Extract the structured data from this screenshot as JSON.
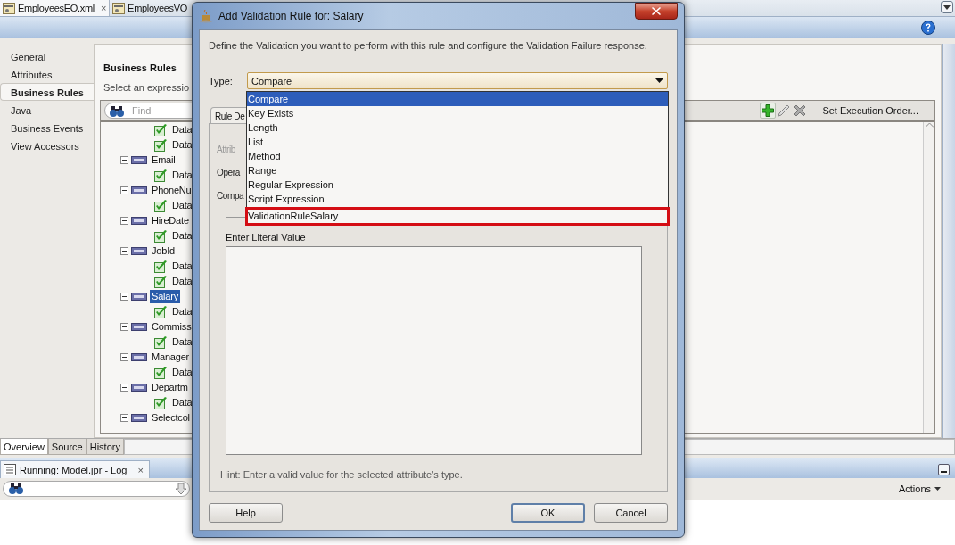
{
  "doc_tabs": [
    {
      "label": "EmployeesEO.xml",
      "close": "×",
      "selected": true
    },
    {
      "label": "EmployeesVO",
      "selected": false
    }
  ],
  "nav": [
    {
      "label": "General",
      "selected": false
    },
    {
      "label": "Attributes",
      "selected": false
    },
    {
      "label": "Business Rules",
      "selected": true
    },
    {
      "label": "Java",
      "selected": false
    },
    {
      "label": "Business Events",
      "selected": false
    },
    {
      "label": "View Accessors",
      "selected": false
    }
  ],
  "panel": {
    "title": "Business Rules",
    "subtitle": "Select an expressio",
    "find_placeholder": "Find",
    "toolbar_action": "Set Execution Order..."
  },
  "tree": [
    {
      "kind": "rule",
      "label": "Data",
      "selected": false
    },
    {
      "kind": "rule",
      "label": "Data",
      "selected": false
    },
    {
      "kind": "attribute",
      "label": "Email",
      "selected": false,
      "children": [
        {
          "kind": "rule",
          "label": "Data",
          "selected": false
        }
      ]
    },
    {
      "kind": "attribute",
      "label": "PhoneNu",
      "selected": false,
      "children": [
        {
          "kind": "rule",
          "label": "Data",
          "selected": false
        }
      ]
    },
    {
      "kind": "attribute",
      "label": "HireDate",
      "selected": false,
      "children": [
        {
          "kind": "rule",
          "label": "Data",
          "selected": false
        }
      ]
    },
    {
      "kind": "attribute",
      "label": "JobId",
      "selected": false,
      "children": [
        {
          "kind": "rule",
          "label": "Data",
          "selected": false
        },
        {
          "kind": "rule",
          "label": "Data",
          "selected": false
        }
      ]
    },
    {
      "kind": "attribute",
      "label": "Salary",
      "selected": true,
      "children": [
        {
          "kind": "rule",
          "label": "Data",
          "selected": false
        }
      ]
    },
    {
      "kind": "attribute",
      "label": "Commiss",
      "selected": false,
      "children": [
        {
          "kind": "rule",
          "label": "Data",
          "selected": false
        }
      ]
    },
    {
      "kind": "attribute",
      "label": "Manager",
      "selected": false,
      "children": [
        {
          "kind": "rule",
          "label": "Data",
          "selected": false
        }
      ]
    },
    {
      "kind": "attribute",
      "label": "Departm",
      "selected": false,
      "children": [
        {
          "kind": "rule",
          "label": "Data",
          "selected": false
        }
      ]
    },
    {
      "kind": "attribute",
      "label": "Selectcol",
      "selected": false
    }
  ],
  "bottom_tabs": [
    {
      "label": "Overview",
      "selected": true
    },
    {
      "label": "Source",
      "selected": false
    },
    {
      "label": "History",
      "selected": false
    }
  ],
  "log": {
    "title": "Running: Model.jpr - Log",
    "close": "×",
    "actions": "Actions"
  },
  "dialog": {
    "title": "Add Validation Rule for: Salary",
    "description": "Define the Validation you want to perform with this rule and configure the Validation Failure response.",
    "type_label": "Type:",
    "type_value": "Compare",
    "options": [
      {
        "label": "Compare",
        "selected": true,
        "highlighted": false
      },
      {
        "label": "Key Exists",
        "selected": false,
        "highlighted": false
      },
      {
        "label": "Length",
        "selected": false,
        "highlighted": false
      },
      {
        "label": "List",
        "selected": false,
        "highlighted": false
      },
      {
        "label": "Method",
        "selected": false,
        "highlighted": false
      },
      {
        "label": "Range",
        "selected": false,
        "highlighted": false
      },
      {
        "label": "Regular Expression",
        "selected": false,
        "highlighted": false
      },
      {
        "label": "Script Expression",
        "selected": false,
        "highlighted": false
      },
      {
        "label": "ValidationRuleSalary",
        "selected": false,
        "highlighted": true
      }
    ],
    "tab": "Rule De",
    "fields": [
      {
        "label": "Attrib",
        "disabled": true
      },
      {
        "label": "Opera",
        "disabled": false
      },
      {
        "label": "Compa",
        "disabled": false
      }
    ],
    "literal_label": "Enter Literal Value",
    "hint": "Hint: Enter a valid value for the selected attribute's type.",
    "buttons": [
      {
        "kind": "left",
        "label": "Help",
        "default": false
      },
      {
        "kind": "right",
        "label": "OK",
        "default": true
      },
      {
        "kind": "right",
        "label": "Cancel",
        "default": false
      }
    ]
  }
}
